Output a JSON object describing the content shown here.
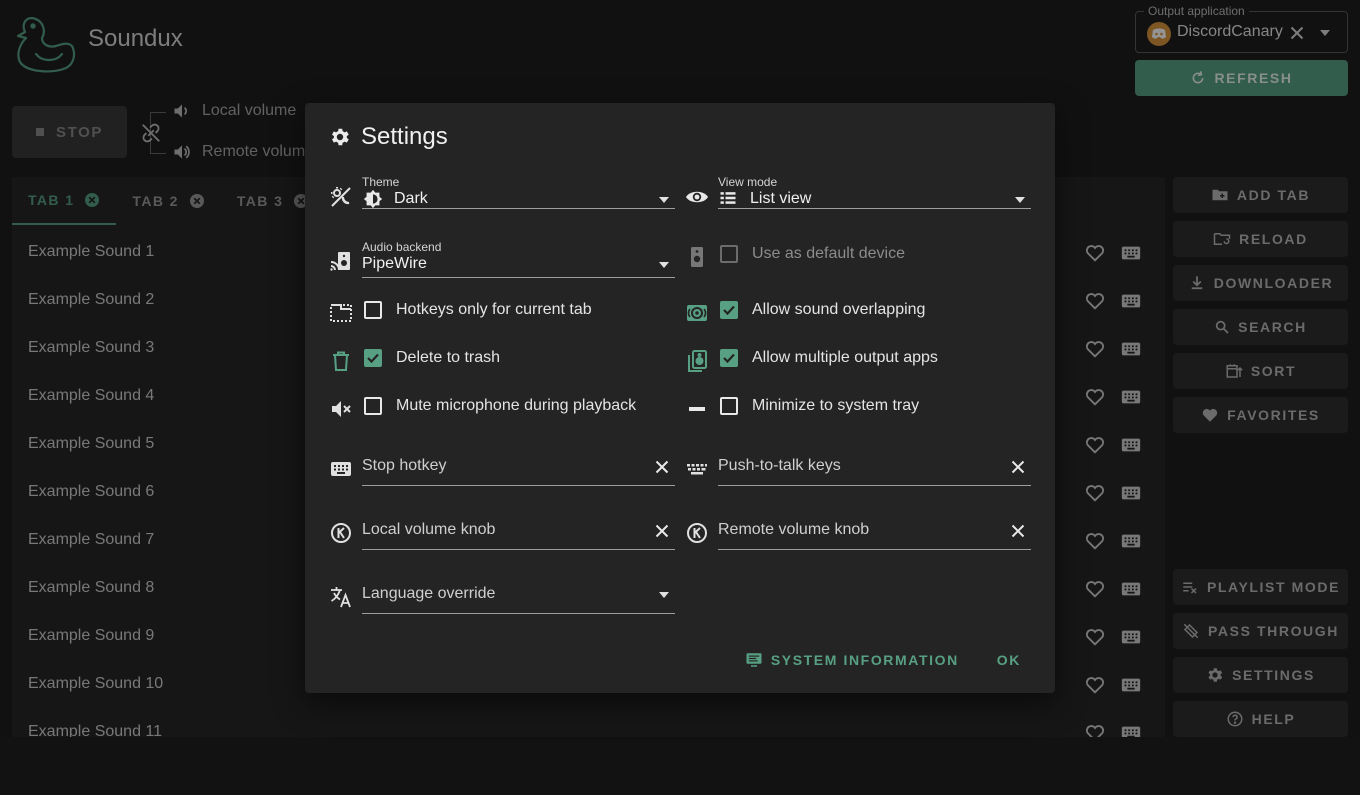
{
  "app": {
    "title": "Soundux",
    "output_app": {
      "legend": "Output application",
      "value": "DiscordCanary"
    },
    "refresh_label": "REFRESH",
    "stop_label": "STOP",
    "local_volume_label": "Local volume",
    "remote_volume_label": "Remote volume",
    "accent_color": "#57a084"
  },
  "tabs": [
    {
      "label": "TAB 1",
      "active": true
    },
    {
      "label": "TAB 2",
      "active": false
    },
    {
      "label": "TAB 3",
      "active": false
    }
  ],
  "sounds": [
    "Example Sound 1",
    "Example Sound 2",
    "Example Sound 3",
    "Example Sound 4",
    "Example Sound 5",
    "Example Sound 6",
    "Example Sound 7",
    "Example Sound 8",
    "Example Sound 9",
    "Example Sound 10",
    "Example Sound 11"
  ],
  "sidebar": {
    "add_tab": "ADD TAB",
    "reload": "RELOAD",
    "downloader": "DOWNLOADER",
    "search": "SEARCH",
    "sort": "SORT",
    "favorites": "FAVORITES",
    "playlist_mode": "PLAYLIST MODE",
    "pass_through": "PASS THROUGH",
    "settings": "SETTINGS",
    "help": "HELP"
  },
  "settings": {
    "title": "Settings",
    "theme": {
      "label": "Theme",
      "value": "Dark"
    },
    "view_mode": {
      "label": "View mode",
      "value": "List view"
    },
    "audio_backend": {
      "label": "Audio backend",
      "value": "PipeWire"
    },
    "use_default_device": {
      "label": "Use as default device",
      "checked": false,
      "disabled": true
    },
    "hotkeys_current_tab": {
      "label": "Hotkeys only for current tab",
      "checked": false
    },
    "allow_overlapping": {
      "label": "Allow sound overlapping",
      "checked": true
    },
    "delete_to_trash": {
      "label": "Delete to trash",
      "checked": true
    },
    "allow_multiple_outputs": {
      "label": "Allow multiple output apps",
      "checked": true
    },
    "mute_mic": {
      "label": "Mute microphone during playback",
      "checked": false
    },
    "minimize_tray": {
      "label": "Minimize to system tray",
      "checked": false
    },
    "stop_hotkey": "Stop hotkey",
    "push_to_talk": "Push-to-talk keys",
    "local_volume_knob": "Local volume knob",
    "remote_volume_knob": "Remote volume knob",
    "language_override": "Language override",
    "system_information_label": "SYSTEM INFORMATION",
    "ok_label": "OK"
  }
}
